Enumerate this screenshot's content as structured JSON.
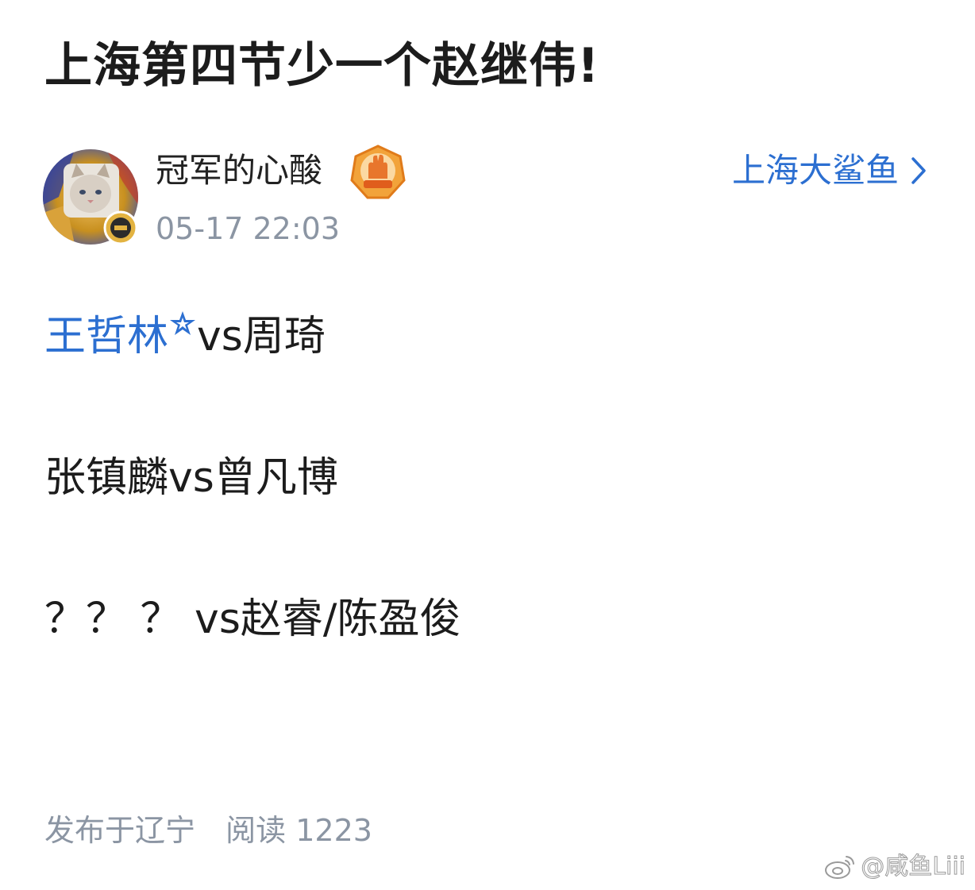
{
  "post": {
    "title": "上海第四节少一个赵继伟!",
    "author": {
      "name": "冠军的心酸",
      "time": "05-17 22:03",
      "avatar_icon": "cat-avatar-icon",
      "medal_icon": "fan-medal-icon"
    },
    "topic": {
      "label": "上海大鲨鱼",
      "icon": "chevron-right-icon"
    },
    "body": {
      "line1": {
        "mention": "王哲林",
        "rest": "vs周琦"
      },
      "line2": "张镇麟vs曾凡博",
      "line3": "？？ ？ vs赵睿/陈盈俊"
    },
    "footer": {
      "location": "发布于辽宁",
      "read_label": "阅读",
      "read_count": "1223"
    }
  },
  "watermark": {
    "text": "@咸鱼Liii",
    "icon": "weibo-logo-icon"
  },
  "colors": {
    "link": "#2c6fd1",
    "meta": "#8b95a3",
    "text": "#1c1c1c"
  }
}
